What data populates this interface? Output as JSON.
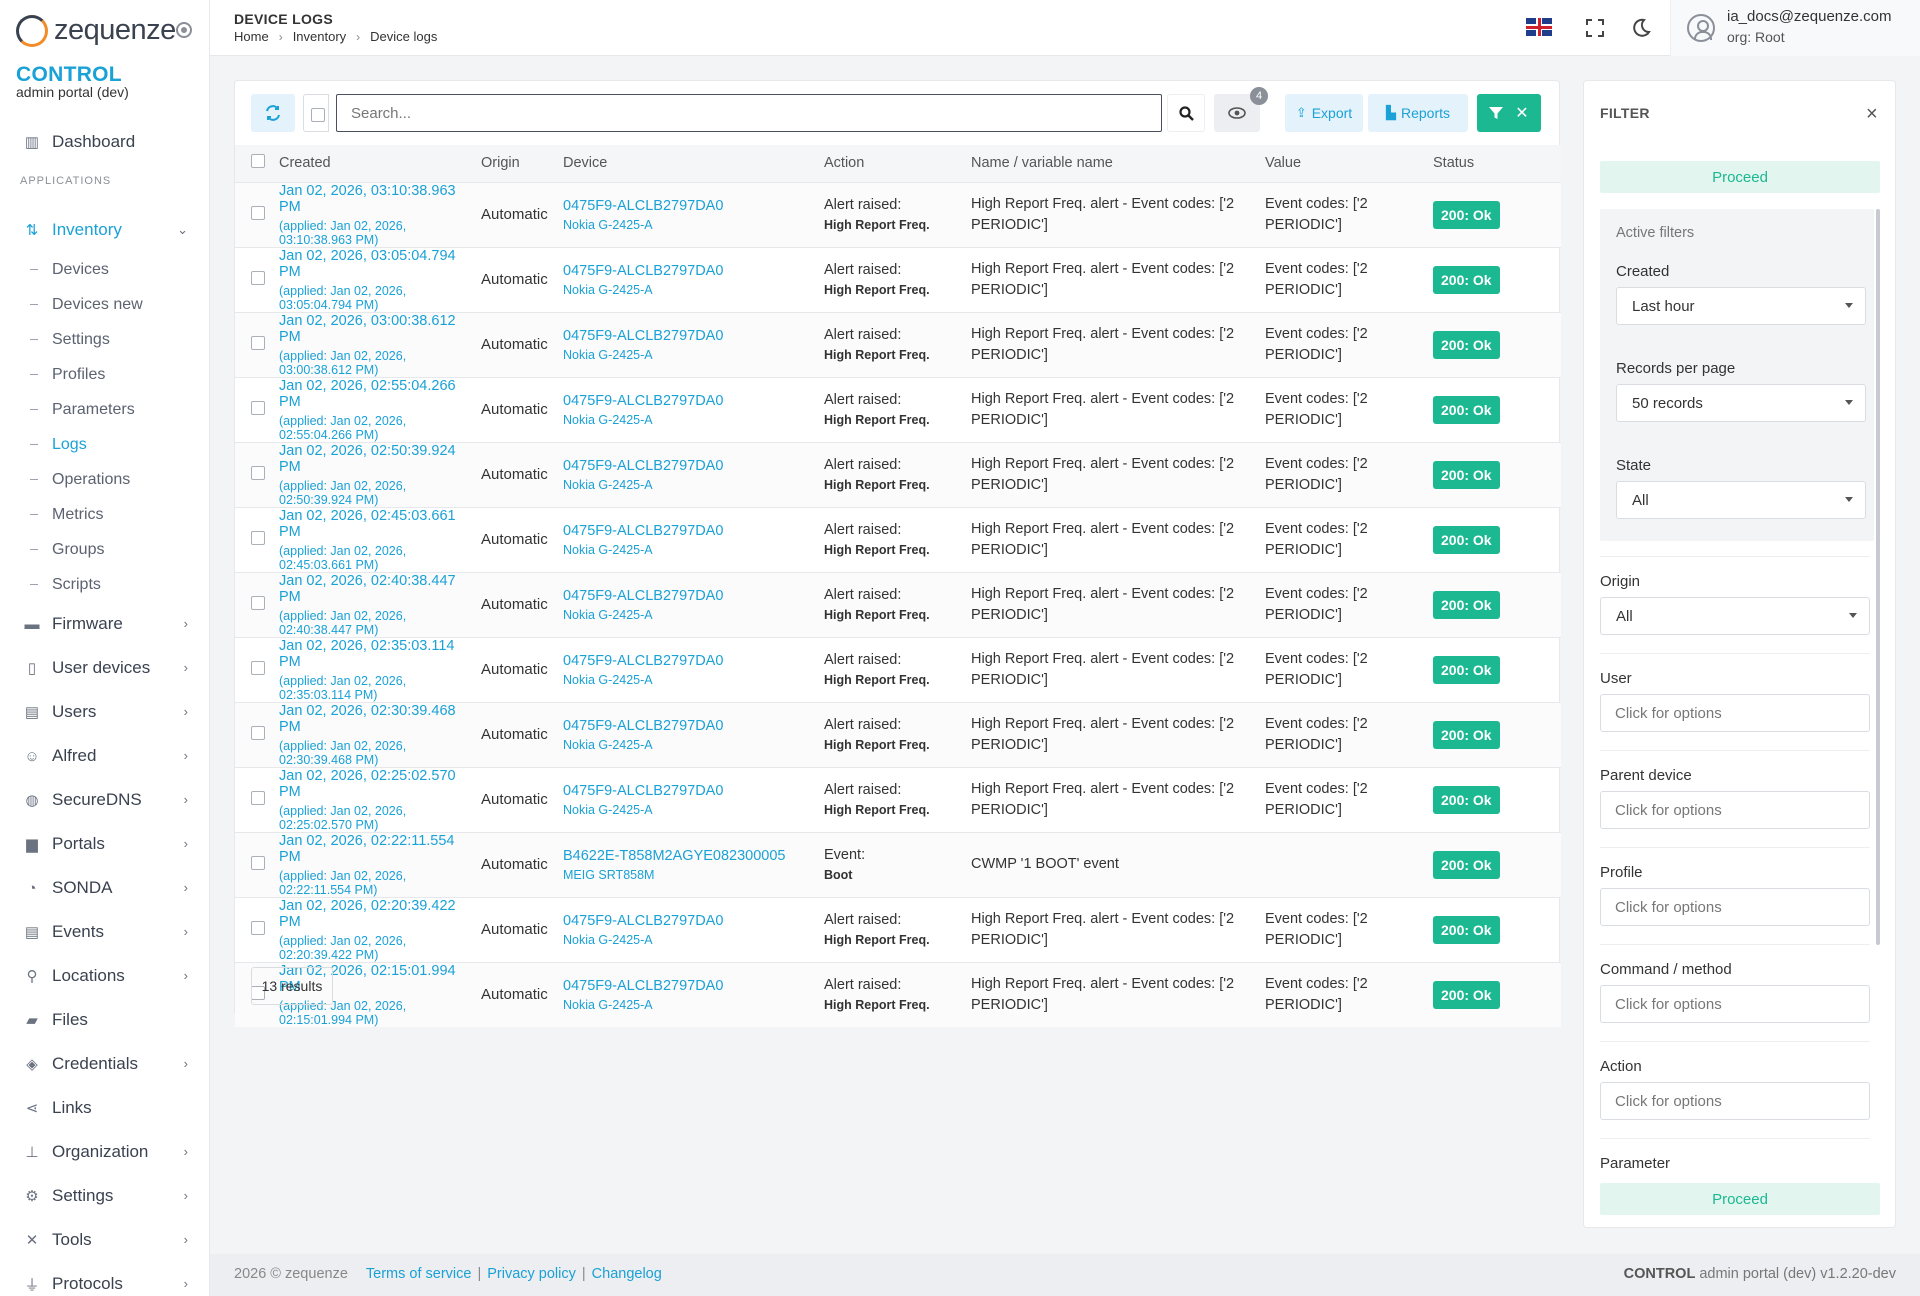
{
  "app": {
    "logo_text": "zequenze",
    "brand_title": "CONTROL",
    "brand_sub": "admin portal (dev)"
  },
  "header": {
    "title": "DEVICE LOGS",
    "breadcrumb": [
      "Home",
      "Inventory",
      "Device logs"
    ],
    "user_email": "ia_docs@zequenze.com",
    "user_org": "org: Root"
  },
  "sidebar": {
    "dashboard": "Dashboard",
    "section_label": "APPLICATIONS",
    "inventory": "Inventory",
    "inventory_sub": [
      "Devices",
      "Devices new",
      "Settings",
      "Profiles",
      "Parameters",
      "Logs",
      "Operations",
      "Metrics",
      "Groups",
      "Scripts"
    ],
    "items": [
      "Firmware",
      "User devices",
      "Users",
      "Alfred",
      "SecureDNS",
      "Portals",
      "SONDA",
      "Events",
      "Locations",
      "Files",
      "Credentials",
      "Links",
      "Organization",
      "Settings",
      "Tools",
      "Protocols"
    ]
  },
  "toolbar": {
    "search_placeholder": "Search...",
    "eye_badge": "4",
    "export_label": "Export",
    "reports_label": "Reports"
  },
  "table": {
    "columns": [
      "Created",
      "Origin",
      "Device",
      "Action",
      "Name / variable name",
      "Value",
      "Status"
    ],
    "rows": [
      {
        "created": "Jan 02, 2026, 03:10:38.963 PM",
        "applied": "(applied: Jan 02, 2026, 03:10:38.963 PM)",
        "origin": "Automatic",
        "device": "0475F9-ALCLB2797DA0",
        "model": "Nokia G-2425-A",
        "action": "Alert raised:",
        "action_sub": "High Report Freq.",
        "name": "High Report Freq. alert - Event codes: ['2 PERIODIC']",
        "value": "Event codes: ['2 PERIODIC']",
        "status": "200: Ok"
      },
      {
        "created": "Jan 02, 2026, 03:05:04.794 PM",
        "applied": "(applied: Jan 02, 2026, 03:05:04.794 PM)",
        "origin": "Automatic",
        "device": "0475F9-ALCLB2797DA0",
        "model": "Nokia G-2425-A",
        "action": "Alert raised:",
        "action_sub": "High Report Freq.",
        "name": "High Report Freq. alert - Event codes: ['2 PERIODIC']",
        "value": "Event codes: ['2 PERIODIC']",
        "status": "200: Ok"
      },
      {
        "created": "Jan 02, 2026, 03:00:38.612 PM",
        "applied": "(applied: Jan 02, 2026, 03:00:38.612 PM)",
        "origin": "Automatic",
        "device": "0475F9-ALCLB2797DA0",
        "model": "Nokia G-2425-A",
        "action": "Alert raised:",
        "action_sub": "High Report Freq.",
        "name": "High Report Freq. alert - Event codes: ['2 PERIODIC']",
        "value": "Event codes: ['2 PERIODIC']",
        "status": "200: Ok"
      },
      {
        "created": "Jan 02, 2026, 02:55:04.266 PM",
        "applied": "(applied: Jan 02, 2026, 02:55:04.266 PM)",
        "origin": "Automatic",
        "device": "0475F9-ALCLB2797DA0",
        "model": "Nokia G-2425-A",
        "action": "Alert raised:",
        "action_sub": "High Report Freq.",
        "name": "High Report Freq. alert - Event codes: ['2 PERIODIC']",
        "value": "Event codes: ['2 PERIODIC']",
        "status": "200: Ok"
      },
      {
        "created": "Jan 02, 2026, 02:50:39.924 PM",
        "applied": "(applied: Jan 02, 2026, 02:50:39.924 PM)",
        "origin": "Automatic",
        "device": "0475F9-ALCLB2797DA0",
        "model": "Nokia G-2425-A",
        "action": "Alert raised:",
        "action_sub": "High Report Freq.",
        "name": "High Report Freq. alert - Event codes: ['2 PERIODIC']",
        "value": "Event codes: ['2 PERIODIC']",
        "status": "200: Ok"
      },
      {
        "created": "Jan 02, 2026, 02:45:03.661 PM",
        "applied": "(applied: Jan 02, 2026, 02:45:03.661 PM)",
        "origin": "Automatic",
        "device": "0475F9-ALCLB2797DA0",
        "model": "Nokia G-2425-A",
        "action": "Alert raised:",
        "action_sub": "High Report Freq.",
        "name": "High Report Freq. alert - Event codes: ['2 PERIODIC']",
        "value": "Event codes: ['2 PERIODIC']",
        "status": "200: Ok"
      },
      {
        "created": "Jan 02, 2026, 02:40:38.447 PM",
        "applied": "(applied: Jan 02, 2026, 02:40:38.447 PM)",
        "origin": "Automatic",
        "device": "0475F9-ALCLB2797DA0",
        "model": "Nokia G-2425-A",
        "action": "Alert raised:",
        "action_sub": "High Report Freq.",
        "name": "High Report Freq. alert - Event codes: ['2 PERIODIC']",
        "value": "Event codes: ['2 PERIODIC']",
        "status": "200: Ok"
      },
      {
        "created": "Jan 02, 2026, 02:35:03.114 PM",
        "applied": "(applied: Jan 02, 2026, 02:35:03.114 PM)",
        "origin": "Automatic",
        "device": "0475F9-ALCLB2797DA0",
        "model": "Nokia G-2425-A",
        "action": "Alert raised:",
        "action_sub": "High Report Freq.",
        "name": "High Report Freq. alert - Event codes: ['2 PERIODIC']",
        "value": "Event codes: ['2 PERIODIC']",
        "status": "200: Ok"
      },
      {
        "created": "Jan 02, 2026, 02:30:39.468 PM",
        "applied": "(applied: Jan 02, 2026, 02:30:39.468 PM)",
        "origin": "Automatic",
        "device": "0475F9-ALCLB2797DA0",
        "model": "Nokia G-2425-A",
        "action": "Alert raised:",
        "action_sub": "High Report Freq.",
        "name": "High Report Freq. alert - Event codes: ['2 PERIODIC']",
        "value": "Event codes: ['2 PERIODIC']",
        "status": "200: Ok"
      },
      {
        "created": "Jan 02, 2026, 02:25:02.570 PM",
        "applied": "(applied: Jan 02, 2026, 02:25:02.570 PM)",
        "origin": "Automatic",
        "device": "0475F9-ALCLB2797DA0",
        "model": "Nokia G-2425-A",
        "action": "Alert raised:",
        "action_sub": "High Report Freq.",
        "name": "High Report Freq. alert - Event codes: ['2 PERIODIC']",
        "value": "Event codes: ['2 PERIODIC']",
        "status": "200: Ok"
      },
      {
        "created": "Jan 02, 2026, 02:22:11.554 PM",
        "applied": "(applied: Jan 02, 2026, 02:22:11.554 PM)",
        "origin": "Automatic",
        "device": "B4622E-T858M2AGYE082300005",
        "model": "MEIG SRT858M",
        "action": "Event:",
        "action_sub": "Boot",
        "name": "CWMP '1 BOOT' event",
        "value": "",
        "status": "200: Ok"
      },
      {
        "created": "Jan 02, 2026, 02:20:39.422 PM",
        "applied": "(applied: Jan 02, 2026, 02:20:39.422 PM)",
        "origin": "Automatic",
        "device": "0475F9-ALCLB2797DA0",
        "model": "Nokia G-2425-A",
        "action": "Alert raised:",
        "action_sub": "High Report Freq.",
        "name": "High Report Freq. alert - Event codes: ['2 PERIODIC']",
        "value": "Event codes: ['2 PERIODIC']",
        "status": "200: Ok"
      },
      {
        "created": "Jan 02, 2026, 02:15:01.994 PM",
        "applied": "(applied: Jan 02, 2026, 02:15:01.994 PM)",
        "origin": "Automatic",
        "device": "0475F9-ALCLB2797DA0",
        "model": "Nokia G-2425-A",
        "action": "Alert raised:",
        "action_sub": "High Report Freq.",
        "name": "High Report Freq. alert - Event codes: ['2 PERIODIC']",
        "value": "Event codes: ['2 PERIODIC']",
        "status": "200: Ok"
      }
    ],
    "results": "13 results"
  },
  "filter": {
    "title": "FILTER",
    "proceed": "Proceed",
    "active_filters": "Active filters",
    "created_label": "Created",
    "created_value": "Last hour",
    "records_label": "Records per page",
    "records_value": "50 records",
    "state_label": "State",
    "state_value": "All",
    "origin_label": "Origin",
    "origin_value": "All",
    "options_placeholder": "Click for options",
    "user_label": "User",
    "parent_label": "Parent device",
    "profile_label": "Profile",
    "command_label": "Command / method",
    "action_label": "Action",
    "parameter_label": "Parameter"
  },
  "footer": {
    "copyright": "2026 © zequenze",
    "terms": "Terms of service",
    "privacy": "Privacy policy",
    "changelog": "Changelog",
    "version_brand": "CONTROL",
    "version_text": "admin portal (dev) v1.2.20-dev"
  },
  "colors": {
    "accent": "#1aa1d6",
    "success": "#1bb891",
    "background": "#f3f4f6"
  }
}
